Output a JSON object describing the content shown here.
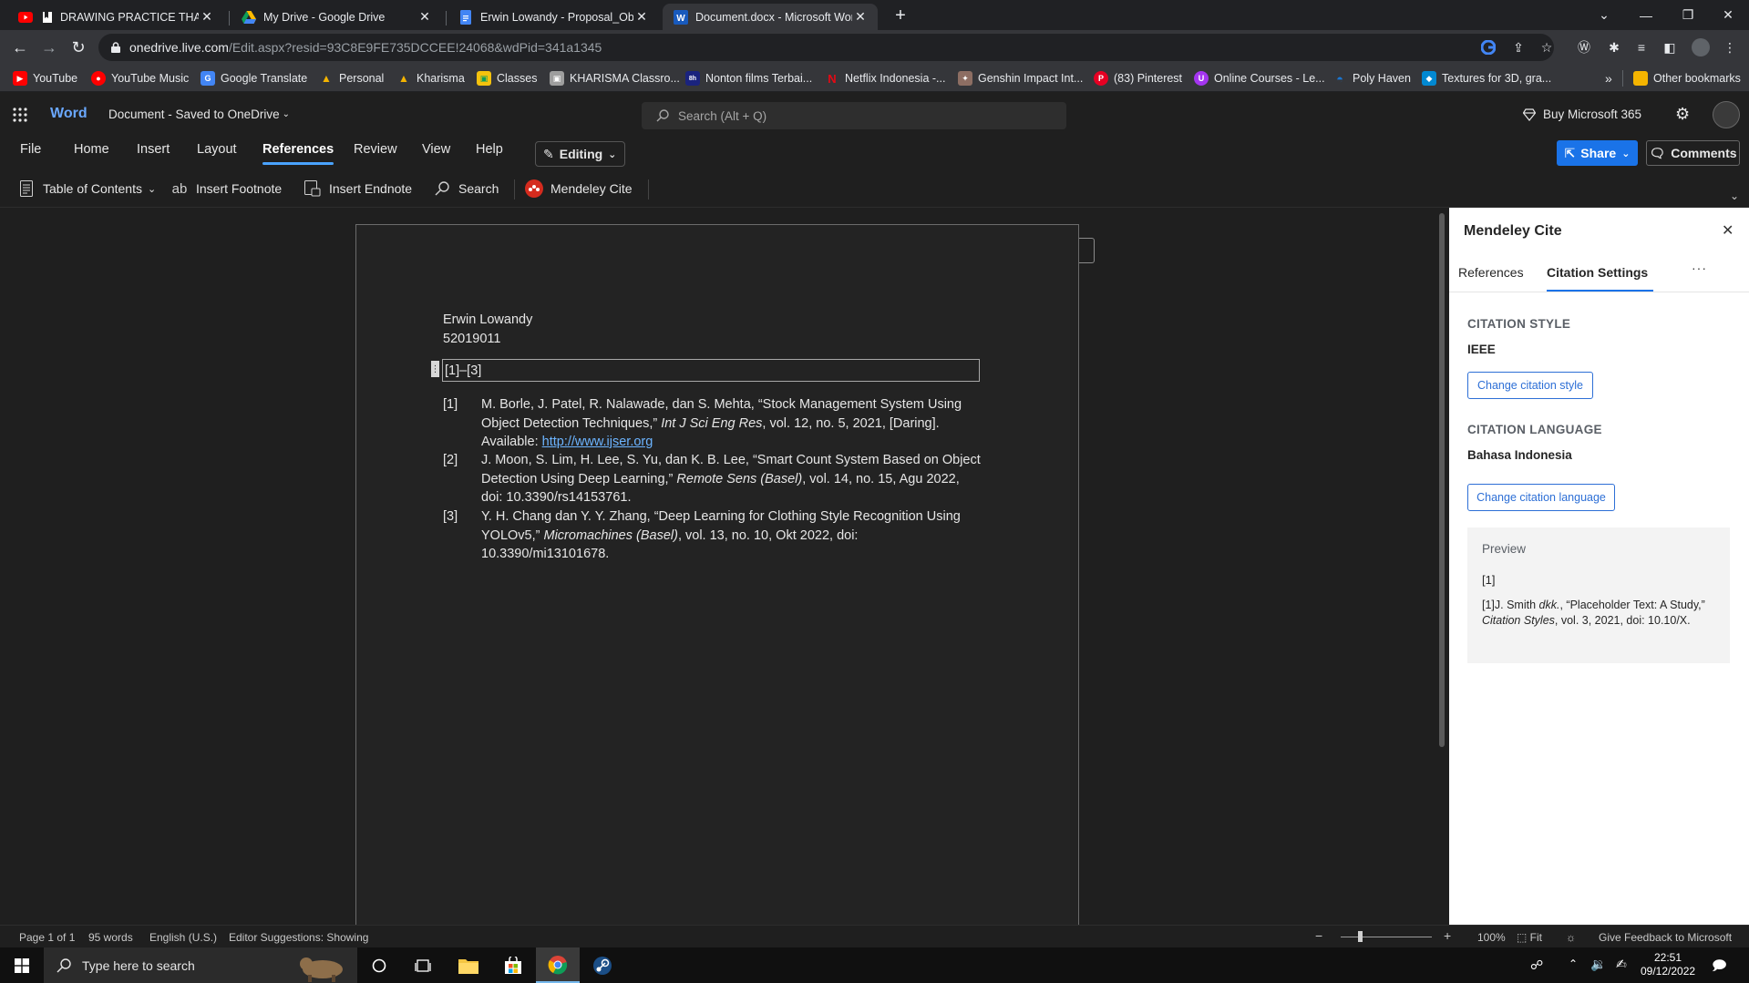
{
  "browser": {
    "tabs": [
      {
        "title": "DRAWING PRACTICE THAT M",
        "icon": "youtube-icon"
      },
      {
        "title": "My Drive - Google Drive",
        "icon": "google-drive-icon"
      },
      {
        "title": "Erwin Lowandy - Proposal_Objec",
        "icon": "google-docs-icon"
      },
      {
        "title": "Document.docx - Microsoft Word",
        "icon": "word-icon"
      }
    ],
    "url_host": "onedrive.live.com",
    "url_path": "/Edit.aspx?resid=93C8E9FE735DCCEE!24068&wdPid=341a1345",
    "bookmarks": [
      {
        "label": "YouTube",
        "color": "#ff0000"
      },
      {
        "label": "YouTube Music",
        "color": "#ff0000"
      },
      {
        "label": "Google Translate",
        "color": "#4285f4"
      },
      {
        "label": "Personal",
        "color": "#f4b400"
      },
      {
        "label": "Kharisma",
        "color": "#f4b400"
      },
      {
        "label": "Classes",
        "color": "#f4c20d"
      },
      {
        "label": "KHARISMA Classro...",
        "color": "#9e9e9e"
      },
      {
        "label": "Nonton films Terbai...",
        "color": "#1a237e"
      },
      {
        "label": "Netflix Indonesia -...",
        "color": "#e50914"
      },
      {
        "label": "Genshin Impact Int...",
        "color": "#8d6e63"
      },
      {
        "label": "(83) Pinterest",
        "color": "#e60023"
      },
      {
        "label": "Online Courses - Le...",
        "color": "#a435f0"
      },
      {
        "label": "Poly Haven",
        "color": "#1976d2"
      },
      {
        "label": "Textures for 3D, gra...",
        "color": "#0288d1"
      }
    ],
    "other_bookmarks": "Other bookmarks"
  },
  "word": {
    "app_name": "Word",
    "doc_title": "Document",
    "save_status": "Saved to OneDrive",
    "search_placeholder": "Search (Alt + Q)",
    "buy_label": "Buy Microsoft 365",
    "ribbon_tabs": [
      "File",
      "Home",
      "Insert",
      "Layout",
      "References",
      "Review",
      "View",
      "Help"
    ],
    "active_tab": "References",
    "editing_label": "Editing",
    "share_label": "Share",
    "comments_label": "Comments",
    "commands": {
      "toc": "Table of Contents",
      "footnote": "Insert Footnote",
      "endnote": "Insert Endnote",
      "search": "Search",
      "mendeley": "Mendeley Cite"
    }
  },
  "document": {
    "author": "Erwin Lowandy",
    "student_id": "52019011",
    "citation": "[1]–[3]",
    "references": [
      {
        "num": "[1]",
        "pre": "M. Borle, J. Patel, R. Nalawade, dan S. Mehta, “Stock Management System Using Object Detection Techniques,” ",
        "journal": "Int J Sci Eng Res",
        "post": ", vol. 12, no. 5, 2021, [Daring]. Available: ",
        "link": "http://www.ijser.org"
      },
      {
        "num": "[2]",
        "pre": "J. Moon, S. Lim, H. Lee, S. Yu, dan K. B. Lee, “Smart Count System Based on Object Detection Using Deep Learning,” ",
        "journal": "Remote Sens (Basel)",
        "post": ", vol. 14, no. 15, Agu 2022, doi: 10.3390/rs14153761.",
        "link": ""
      },
      {
        "num": "[3]",
        "pre": "Y. H. Chang dan Y. Y. Zhang, “Deep Learning for Clothing Style Recognition Using YOLOv5,” ",
        "journal": "Micromachines (Basel)",
        "post": ", vol. 13, no. 10, Okt 2022, doi: 10.3390/mi13101678.",
        "link": ""
      }
    ]
  },
  "mendeley": {
    "title": "Mendeley Cite",
    "tabs": [
      "References",
      "Citation Settings"
    ],
    "active_tab": "Citation Settings",
    "more": "···",
    "style_caption": "CITATION STYLE",
    "style_value": "IEEE",
    "change_style": "Change citation style",
    "language_caption": "CITATION LANGUAGE",
    "language_value": "Bahasa Indonesia",
    "change_language": "Change citation language",
    "preview_caption": "Preview",
    "preview_citation": "[1]",
    "preview_ref_pre": "[1]J. Smith ",
    "preview_ref_etal": "dkk.",
    "preview_ref_mid": ", “Placeholder Text: A Study,” ",
    "preview_ref_journal": "Citation Styles",
    "preview_ref_post": ", vol. 3, 2021, doi: 10.10/X."
  },
  "status": {
    "page": "Page 1 of 1",
    "words": "95 words",
    "language": "English (U.S.)",
    "editor": "Editor Suggestions: Showing",
    "zoom": "100%",
    "fit": "Fit",
    "feedback": "Give Feedback to Microsoft"
  },
  "taskbar": {
    "search_placeholder": "Type here to search",
    "time": "22:51",
    "date": "09/12/2022"
  },
  "colors": {
    "accent": "#0f6cbd",
    "link": "#6cb4ff",
    "mendeley": "#d52b1e"
  }
}
